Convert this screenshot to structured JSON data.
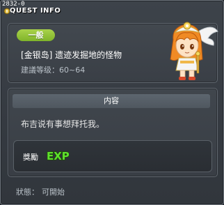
{
  "window": {
    "id_label": "2832-0",
    "title": "QUEST INFO"
  },
  "quest": {
    "category_badge": "一般",
    "name": "[金银岛] 遗迹发掘地的怪物",
    "level_label": "建議等级：60~64"
  },
  "content": {
    "header": "内容",
    "description": "布吉说有事想拜托我。"
  },
  "reward": {
    "label": "獎勵",
    "icon": "exp-icon",
    "icon_text": "EXP"
  },
  "status": {
    "label": "狀態：",
    "value": "可開始"
  },
  "colors": {
    "badge_green": "#8cc138",
    "exp_green": "#5ee02c",
    "background": "#3a3f46"
  }
}
